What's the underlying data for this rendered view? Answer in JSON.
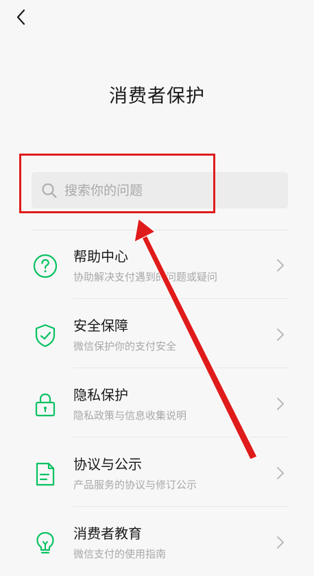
{
  "header": {
    "back_icon": "chevron-left-icon",
    "title": "消费者保护"
  },
  "search": {
    "placeholder": "搜索你的问题",
    "icon": "search-icon"
  },
  "menu": {
    "items": [
      {
        "title": "帮助中心",
        "subtitle": "协助解决支付遇到的问题或疑问",
        "icon": "question-circle-icon"
      },
      {
        "title": "安全保障",
        "subtitle": "微信保护你的支付安全",
        "icon": "shield-check-icon"
      },
      {
        "title": "隐私保护",
        "subtitle": "隐私政策与信息收集说明",
        "icon": "lock-icon"
      },
      {
        "title": "协议与公示",
        "subtitle": "产品服务的协议与修订公示",
        "icon": "document-icon"
      },
      {
        "title": "消费者教育",
        "subtitle": "微信支付的使用指南",
        "icon": "lightbulb-icon"
      }
    ]
  },
  "colors": {
    "accent": "#07c160",
    "annotation": "#e01b1b",
    "background": "#f7f7f7"
  }
}
